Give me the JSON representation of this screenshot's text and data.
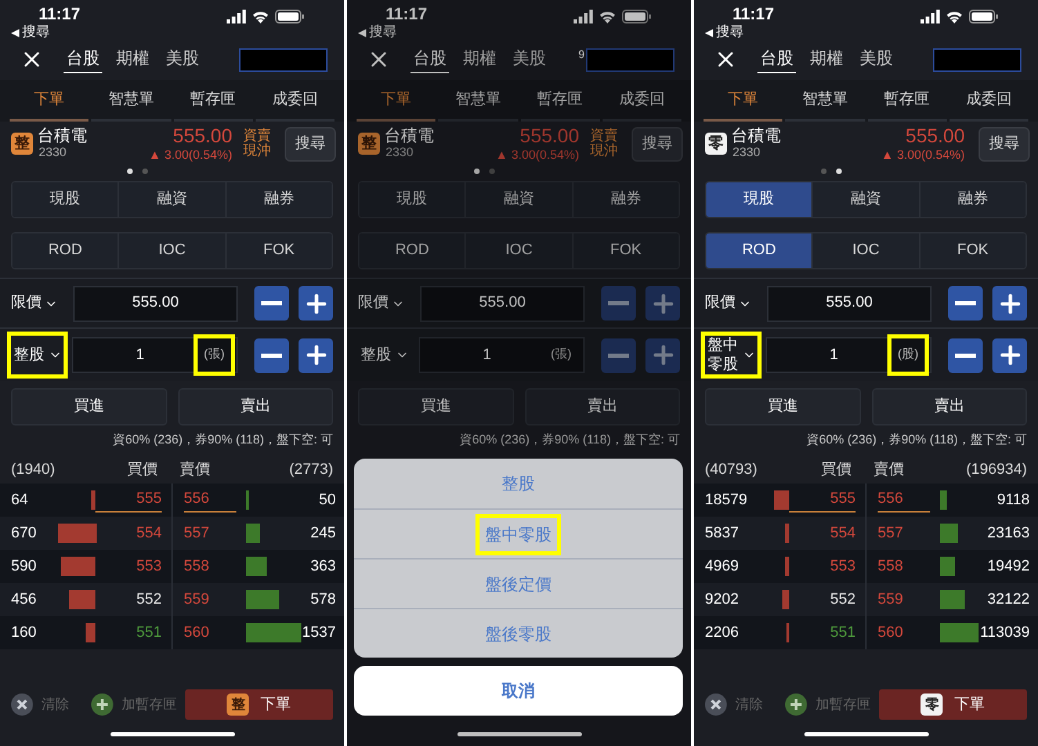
{
  "panels": [
    {
      "status": {
        "time": "11:17",
        "back": "搜尋"
      },
      "market_tabs": [
        {
          "label": "台股",
          "selected": true
        },
        {
          "label": "期權",
          "selected": false
        },
        {
          "label": "美股",
          "selected": false
        }
      ],
      "order_tabs": [
        {
          "label": "下單",
          "selected": true
        },
        {
          "label": "智慧單",
          "selected": false
        },
        {
          "label": "暫存匣",
          "selected": false
        },
        {
          "label": "成委回",
          "selected": false
        }
      ],
      "stock": {
        "kind": "whole",
        "badge": "整",
        "name": "台積電",
        "code": "2330",
        "price": "555.00",
        "change": "▲ 3.00(0.54%)",
        "tags": [
          "資賣",
          "現沖"
        ]
      },
      "search_button": "搜尋",
      "page_dots": [
        {
          "selected": true
        },
        {
          "selected": false
        }
      ],
      "trade_types": [
        {
          "label": "現股",
          "selected": false
        },
        {
          "label": "融資",
          "selected": false
        },
        {
          "label": "融券",
          "selected": false
        }
      ],
      "time_in_force": [
        {
          "label": "ROD",
          "selected": false
        },
        {
          "label": "IOC",
          "selected": false
        },
        {
          "label": "FOK",
          "selected": false
        }
      ],
      "price_row": {
        "type": "限價",
        "value": "555.00"
      },
      "qty_row": {
        "lot_type": "整股",
        "lot_highlighted": true,
        "value": "1",
        "unit": "(張)",
        "unit_highlighted": true
      },
      "buy": "買進",
      "sell": "賣出",
      "margin_info": "資60% (236)，券90% (118)，盤下空: 可",
      "order_book": {
        "bid_total": "(1940)",
        "bid_header": "買價",
        "ask_header": "賣價",
        "ask_total": "(2773)",
        "rows": [
          {
            "bid": {
              "qty": "64",
              "price": "555",
              "kind": "up"
            },
            "ask": {
              "price": "556",
              "kind": "up",
              "qty": "50"
            }
          },
          {
            "bid": {
              "qty": "670",
              "price": "554",
              "kind": "up"
            },
            "ask": {
              "price": "557",
              "kind": "up",
              "qty": "245"
            }
          },
          {
            "bid": {
              "qty": "590",
              "price": "553",
              "kind": "up"
            },
            "ask": {
              "price": "558",
              "kind": "up",
              "qty": "363"
            }
          },
          {
            "bid": {
              "qty": "456",
              "price": "552",
              "kind": "flat"
            },
            "ask": {
              "price": "559",
              "kind": "up",
              "qty": "578"
            }
          },
          {
            "bid": {
              "qty": "160",
              "price": "551",
              "kind": "down"
            },
            "ask": {
              "price": "560",
              "kind": "up",
              "qty": "1537"
            }
          }
        ]
      },
      "bottom_bar": {
        "clear": "清除",
        "add": "加暫存匣",
        "submit_badge": "整",
        "submit": "下單"
      }
    },
    {
      "status": {
        "time": "11:17",
        "back": "搜尋"
      },
      "market_tabs": [
        {
          "label": "台股",
          "selected": true
        },
        {
          "label": "期權",
          "selected": false
        },
        {
          "label": "美股",
          "selected": false
        }
      ],
      "account_prefix": "9",
      "order_tabs": [
        {
          "label": "下單",
          "selected": true
        },
        {
          "label": "智慧單",
          "selected": false
        },
        {
          "label": "暫存匣",
          "selected": false
        },
        {
          "label": "成委回",
          "selected": false
        }
      ],
      "stock": {
        "kind": "whole",
        "badge": "整",
        "name": "台積電",
        "code": "2330",
        "price": "555.00",
        "change": "▲ 3.00(0.54%)",
        "tags": [
          "資賣",
          "現沖"
        ]
      },
      "search_button": "搜尋",
      "page_dots": [
        {
          "selected": true
        },
        {
          "selected": false
        }
      ],
      "trade_types": [
        {
          "label": "現股",
          "selected": false
        },
        {
          "label": "融資",
          "selected": false
        },
        {
          "label": "融券",
          "selected": false
        }
      ],
      "time_in_force": [
        {
          "label": "ROD",
          "selected": false
        },
        {
          "label": "IOC",
          "selected": false
        },
        {
          "label": "FOK",
          "selected": false
        }
      ],
      "price_row": {
        "type": "限價",
        "value": "555.00"
      },
      "qty_row": {
        "lot_type": "整股",
        "lot_highlighted": false,
        "value": "1",
        "unit": "(張)",
        "unit_highlighted": false
      },
      "buy": "買進",
      "sell": "賣出",
      "margin_info": "資60% (236)，券90% (118)，盤下空: 可",
      "action_sheet": {
        "options": [
          {
            "label": "整股",
            "highlighted": false
          },
          {
            "label": "盤中零股",
            "highlighted": true
          },
          {
            "label": "盤後定價",
            "highlighted": false
          },
          {
            "label": "盤後零股",
            "highlighted": false
          }
        ],
        "cancel": "取消"
      }
    },
    {
      "status": {
        "time": "11:17",
        "back": "搜尋"
      },
      "market_tabs": [
        {
          "label": "台股",
          "selected": true
        },
        {
          "label": "期權",
          "selected": false
        },
        {
          "label": "美股",
          "selected": false
        }
      ],
      "order_tabs": [
        {
          "label": "下單",
          "selected": true
        },
        {
          "label": "智慧單",
          "selected": false
        },
        {
          "label": "暫存匣",
          "selected": false
        },
        {
          "label": "成委回",
          "selected": false
        }
      ],
      "stock": {
        "kind": "odd",
        "badge": "零",
        "name": "台積電",
        "code": "2330",
        "price": "555.00",
        "change": "▲ 3.00(0.54%)"
      },
      "search_button": "搜尋",
      "page_dots": [
        {
          "selected": false
        },
        {
          "selected": true
        }
      ],
      "trade_types": [
        {
          "label": "現股",
          "selected": true
        },
        {
          "label": "融資",
          "selected": false
        },
        {
          "label": "融券",
          "selected": false
        }
      ],
      "time_in_force": [
        {
          "label": "ROD",
          "selected": true
        },
        {
          "label": "IOC",
          "selected": false
        },
        {
          "label": "FOK",
          "selected": false
        }
      ],
      "price_row": {
        "type": "限價",
        "value": "555.00"
      },
      "qty_row": {
        "lot_type": "盤中零股",
        "lot_highlighted": true,
        "value": "1",
        "unit": "(股)",
        "unit_highlighted": true
      },
      "buy": "買進",
      "sell": "賣出",
      "margin_info": "資60% (236)，券90% (118)，盤下空: 可",
      "order_book": {
        "bid_total": "(40793)",
        "bid_header": "買價",
        "ask_header": "賣價",
        "ask_total": "(196934)",
        "rows": [
          {
            "bid": {
              "qty": "18579",
              "price": "555",
              "kind": "up"
            },
            "ask": {
              "price": "556",
              "kind": "up",
              "qty": "9118"
            }
          },
          {
            "bid": {
              "qty": "5837",
              "price": "554",
              "kind": "up"
            },
            "ask": {
              "price": "557",
              "kind": "up",
              "qty": "23163"
            }
          },
          {
            "bid": {
              "qty": "4969",
              "price": "553",
              "kind": "up"
            },
            "ask": {
              "price": "558",
              "kind": "up",
              "qty": "19492"
            }
          },
          {
            "bid": {
              "qty": "9202",
              "price": "552",
              "kind": "flat"
            },
            "ask": {
              "price": "559",
              "kind": "up",
              "qty": "32122"
            }
          },
          {
            "bid": {
              "qty": "2206",
              "price": "551",
              "kind": "down"
            },
            "ask": {
              "price": "560",
              "kind": "up",
              "qty": "113039"
            }
          }
        ]
      },
      "bottom_bar": {
        "clear": "清除",
        "add": "加暫存匣",
        "submit_badge": "零",
        "submit": "下單"
      }
    }
  ]
}
